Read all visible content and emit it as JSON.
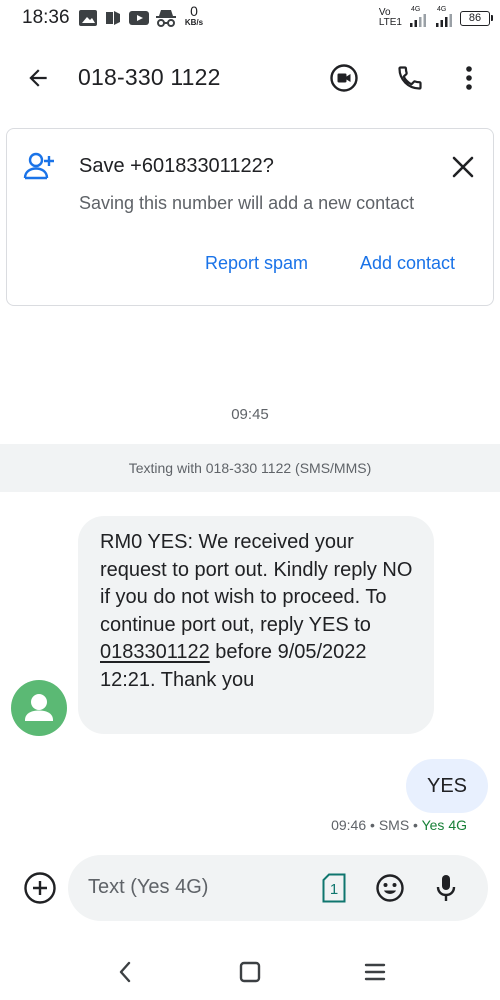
{
  "status_bar": {
    "time": "18:36",
    "net_speed_value": "0",
    "net_speed_unit": "KB/s",
    "volte_top": "Vo",
    "volte_bottom": "LTE1",
    "signal1_label": "4G",
    "signal2_label": "4G",
    "battery_level": "86"
  },
  "app_bar": {
    "title": "018-330 1122",
    "icons": [
      "back-arrow",
      "video-call",
      "phone",
      "more-vert"
    ]
  },
  "save_card": {
    "title": "Save +60183301122?",
    "subtitle": "Saving this number will add a new contact",
    "report_spam_label": "Report spam",
    "add_contact_label": "Add contact"
  },
  "conversation": {
    "timestamp": "09:45",
    "texting_banner": "Texting with 018-330 1122 (SMS/MMS)",
    "incoming_message": {
      "text_before_link": "RM0 YES: We received your request to port out. Kindly reply NO if you do not wish to proceed. To continue port out, reply YES to ",
      "link": "0183301122",
      "text_after_link": " before 9/05/2022 12:21. Thank you"
    },
    "outgoing_message": {
      "text": "YES",
      "time": "09:46",
      "separator": " • ",
      "type": "SMS",
      "sim": "Yes 4G"
    }
  },
  "compose": {
    "placeholder": "Text (Yes 4G)",
    "sim_badge": "1",
    "icons": [
      "add-circle",
      "sim-card",
      "emoji",
      "microphone"
    ]
  },
  "colors": {
    "accent": "#1a73e8",
    "sim_green": "#188038",
    "avatar_green": "#5bb974",
    "incoming_bubble": "#f1f3f4",
    "outgoing_bubble": "#e8f0fe"
  }
}
